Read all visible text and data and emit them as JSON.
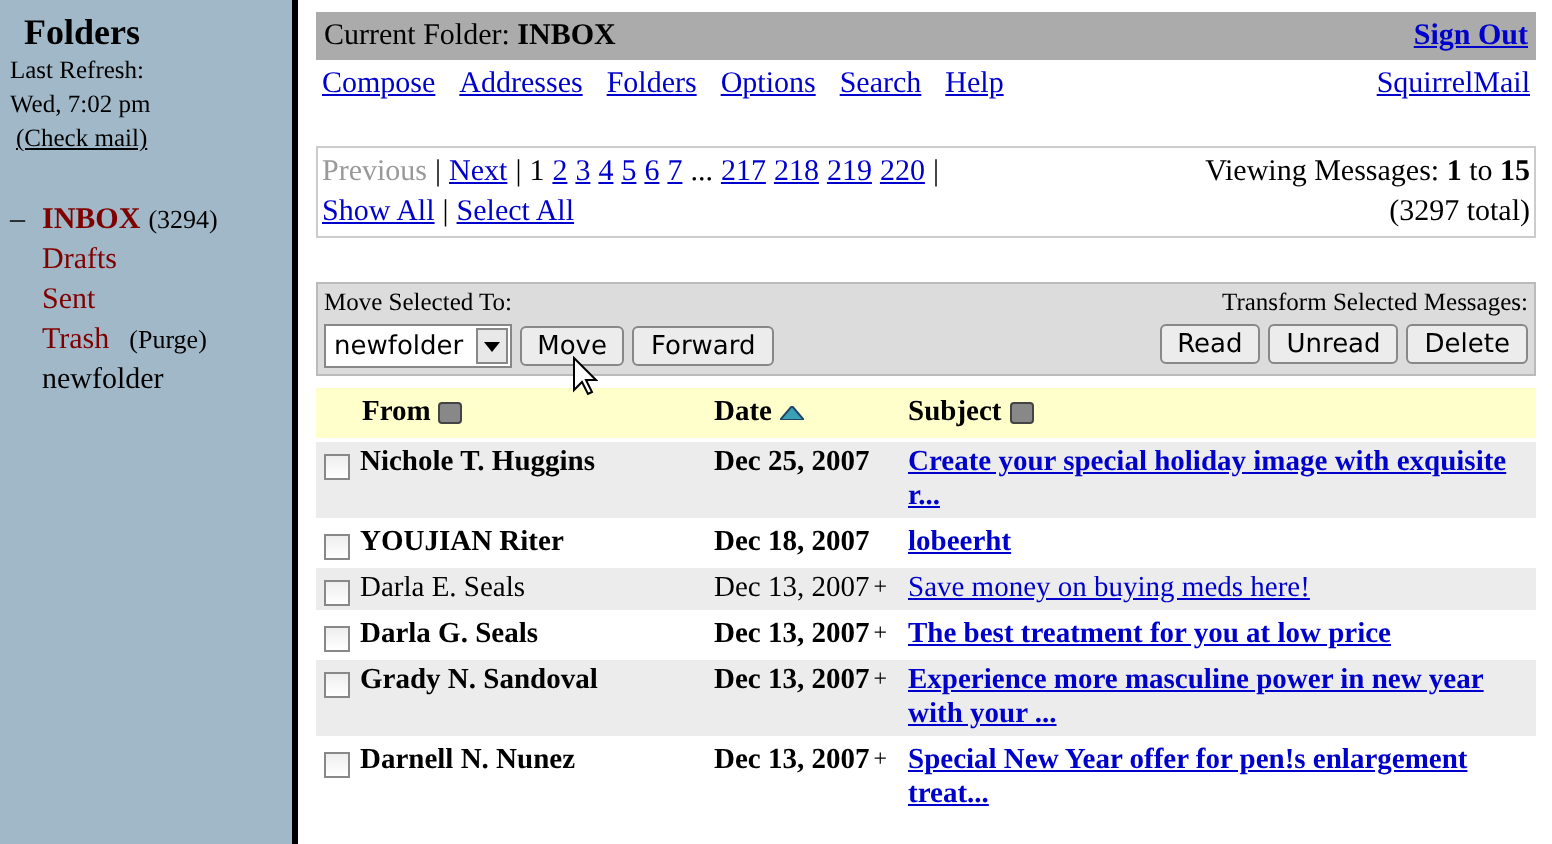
{
  "sidebar": {
    "title": "Folders",
    "refresh_label": "Last Refresh:",
    "refresh_time": "Wed, 7:02 pm",
    "check_mail": "(Check mail)",
    "folders": [
      {
        "name": "INBOX",
        "kind": "special",
        "selected": true,
        "toggle": "–",
        "count": "(3294)"
      },
      {
        "name": "Drafts",
        "kind": "special",
        "selected": false
      },
      {
        "name": "Sent",
        "kind": "special",
        "selected": false
      },
      {
        "name": "Trash",
        "kind": "special",
        "selected": false,
        "action": "(Purge)"
      },
      {
        "name": "newfolder",
        "kind": "normal",
        "selected": false
      }
    ]
  },
  "header": {
    "label": "Current Folder:",
    "folder": "INBOX",
    "sign_out": "Sign Out"
  },
  "nav": {
    "links": [
      "Compose",
      "Addresses",
      "Folders",
      "Options",
      "Search",
      "Help"
    ],
    "brand": "SquirrelMail"
  },
  "pager": {
    "items": [
      {
        "label": "Previous",
        "kind": "disabled"
      },
      {
        "label": "|",
        "kind": "text"
      },
      {
        "label": "Next",
        "kind": "link"
      },
      {
        "label": "|",
        "kind": "text"
      },
      {
        "label": "1",
        "kind": "current"
      },
      {
        "label": "2",
        "kind": "link"
      },
      {
        "label": "3",
        "kind": "link"
      },
      {
        "label": "4",
        "kind": "link"
      },
      {
        "label": "5",
        "kind": "link"
      },
      {
        "label": "6",
        "kind": "link"
      },
      {
        "label": "7",
        "kind": "link"
      },
      {
        "label": "...",
        "kind": "text"
      },
      {
        "label": "217",
        "kind": "link"
      },
      {
        "label": "218",
        "kind": "link"
      },
      {
        "label": "219",
        "kind": "link"
      },
      {
        "label": "220",
        "kind": "link"
      },
      {
        "label": "|",
        "kind": "text"
      },
      {
        "label": "Show All",
        "kind": "link"
      },
      {
        "label": "|",
        "kind": "text"
      },
      {
        "label": "Select All",
        "kind": "link"
      }
    ],
    "viewing": "Viewing Messages: **1** to **15**",
    "total": "(3297 total)"
  },
  "actions": {
    "move_label": "Move Selected To:",
    "folder_select": "newfolder",
    "move": "Move",
    "forward": "Forward",
    "transform_label": "Transform Selected Messages:",
    "buttons": [
      "Read",
      "Unread",
      "Delete"
    ]
  },
  "table": {
    "columns": [
      {
        "label": "From",
        "sorted": false
      },
      {
        "label": "Date",
        "sorted": true
      },
      {
        "label": "Subject",
        "sorted": false
      }
    ],
    "rows": [
      {
        "checked": false,
        "unread": true,
        "from": "Nichole T. Huggins",
        "date": "Dec 25, 2007",
        "subject": "Create your special holiday image with exquisite r..."
      },
      {
        "checked": false,
        "unread": true,
        "from": "YOUJIAN Riter",
        "date": "Dec 18, 2007",
        "subject": "lobeerht"
      },
      {
        "checked": false,
        "unread": false,
        "from": "Darla E. Seals",
        "date": "Dec 13, 2007",
        "flag": "+",
        "subject": "Save money on buying meds here!"
      },
      {
        "checked": false,
        "unread": true,
        "from": "Darla G. Seals",
        "date": "Dec 13, 2007",
        "flag": "+",
        "subject": "The best treatment for you at low price"
      },
      {
        "checked": false,
        "unread": true,
        "from": "Grady N. Sandoval",
        "date": "Dec 13, 2007",
        "flag": "+",
        "subject": "Experience more masculine power in new year with your ..."
      },
      {
        "checked": false,
        "unread": true,
        "from": "Darnell N. Nunez",
        "date": "Dec 13, 2007",
        "flag": "+",
        "subject": "Special New Year offer for pen!s enlargement treat..."
      }
    ]
  }
}
